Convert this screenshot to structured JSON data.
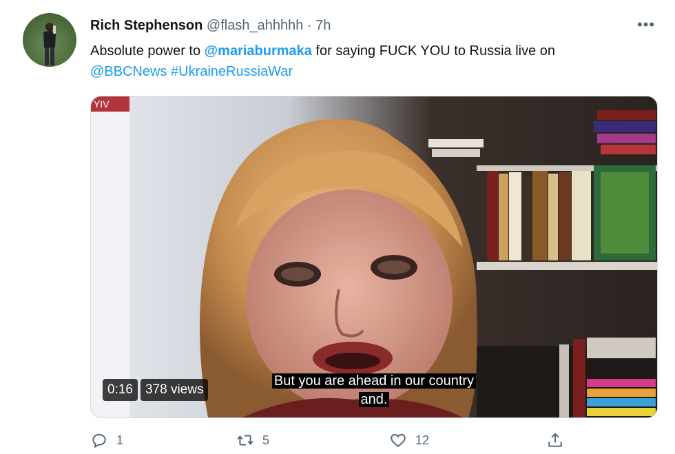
{
  "tweet": {
    "name": "Rich Stephenson",
    "handle": "@flash_ahhhhh",
    "separator": "·",
    "time": "7h",
    "more": "•••",
    "text_part1": "Absolute power to ",
    "mention": "@mariaburmaka",
    "text_part2": " for saying FUCK YOU to Russia live on ",
    "mention2": "@BBCNews",
    "hashtag": "#UkraineRussiaWar"
  },
  "video": {
    "duration": "0:16",
    "views": "378 views",
    "subtitle_line1": "But you are ahead in our country",
    "subtitle_line2": "and.",
    "corner_text": "YIV"
  },
  "actions": {
    "replies": "1",
    "retweets": "5",
    "likes": "12"
  },
  "icons": [
    "reply-icon",
    "retweet-icon",
    "like-icon",
    "share-icon",
    "more-icon"
  ],
  "colors": {
    "accent": "#1d9bf0",
    "secondary_text": "#536471"
  }
}
